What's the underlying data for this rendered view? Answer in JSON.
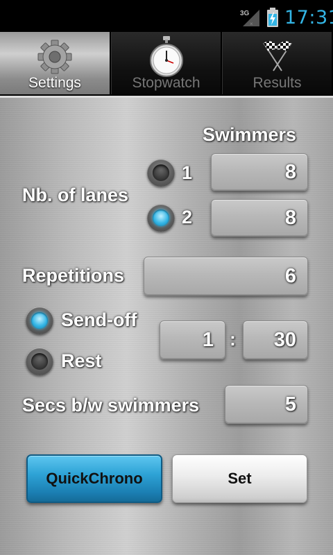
{
  "status_bar": {
    "network": "3G",
    "time": "17:31",
    "accent_color": "#33b5e5",
    "icons": [
      "signal-icon",
      "battery-charging-icon"
    ]
  },
  "tabs": [
    {
      "label": "Settings",
      "icon": "gear-icon",
      "active": true
    },
    {
      "label": "Stopwatch",
      "icon": "stopwatch-icon",
      "active": false
    },
    {
      "label": "Results",
      "icon": "checkered-flags-icon",
      "active": false
    }
  ],
  "settings": {
    "swimmers_header": "Swimmers",
    "lanes_label": "Nb. of lanes",
    "lane_options": [
      {
        "label": "1",
        "selected": false,
        "swimmers": "8"
      },
      {
        "label": "2",
        "selected": true,
        "swimmers": "8"
      }
    ],
    "repetitions_label": "Repetitions",
    "repetitions_value": "6",
    "mode_options": [
      {
        "label": "Send-off",
        "selected": true
      },
      {
        "label": "Rest",
        "selected": false
      }
    ],
    "interval_minutes": "1",
    "interval_separator": ":",
    "interval_seconds": "30",
    "secs_between_label": "Secs b/w swimmers",
    "secs_between_value": "5"
  },
  "buttons": {
    "quickchrono_label": "QuickChrono",
    "set_label": "Set"
  }
}
